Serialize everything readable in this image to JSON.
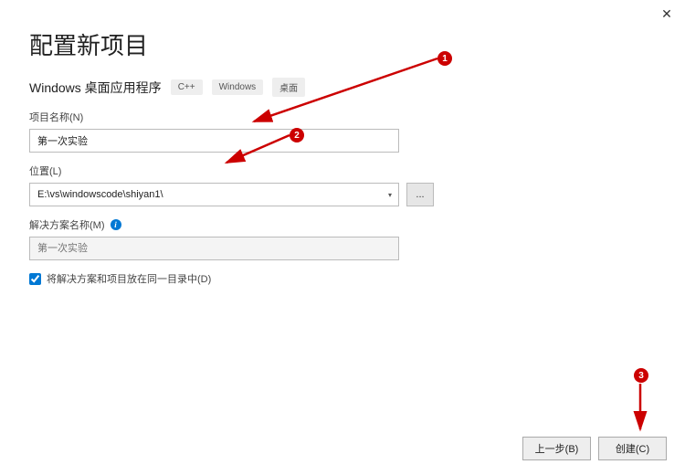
{
  "dialog": {
    "title": "配置新项目",
    "template_name": "Windows 桌面应用程序",
    "tags": {
      "lang": "C++",
      "platform": "Windows",
      "type": "桌面"
    },
    "project_name_label": "项目名称(N)",
    "project_name_value": "第一次实验",
    "location_label": "位置(L)",
    "location_value": "E:\\vs\\windowscode\\shiyan1\\",
    "browse_label": "...",
    "solution_label": "解决方案名称(M)",
    "solution_placeholder": "第一次实验",
    "checkbox_label": "将解决方案和项目放在同一目录中(D)",
    "back_label": "上一步(B)",
    "create_label": "创建(C)"
  },
  "annotations": {
    "badge1": "1",
    "badge2": "2",
    "badge3": "3"
  }
}
